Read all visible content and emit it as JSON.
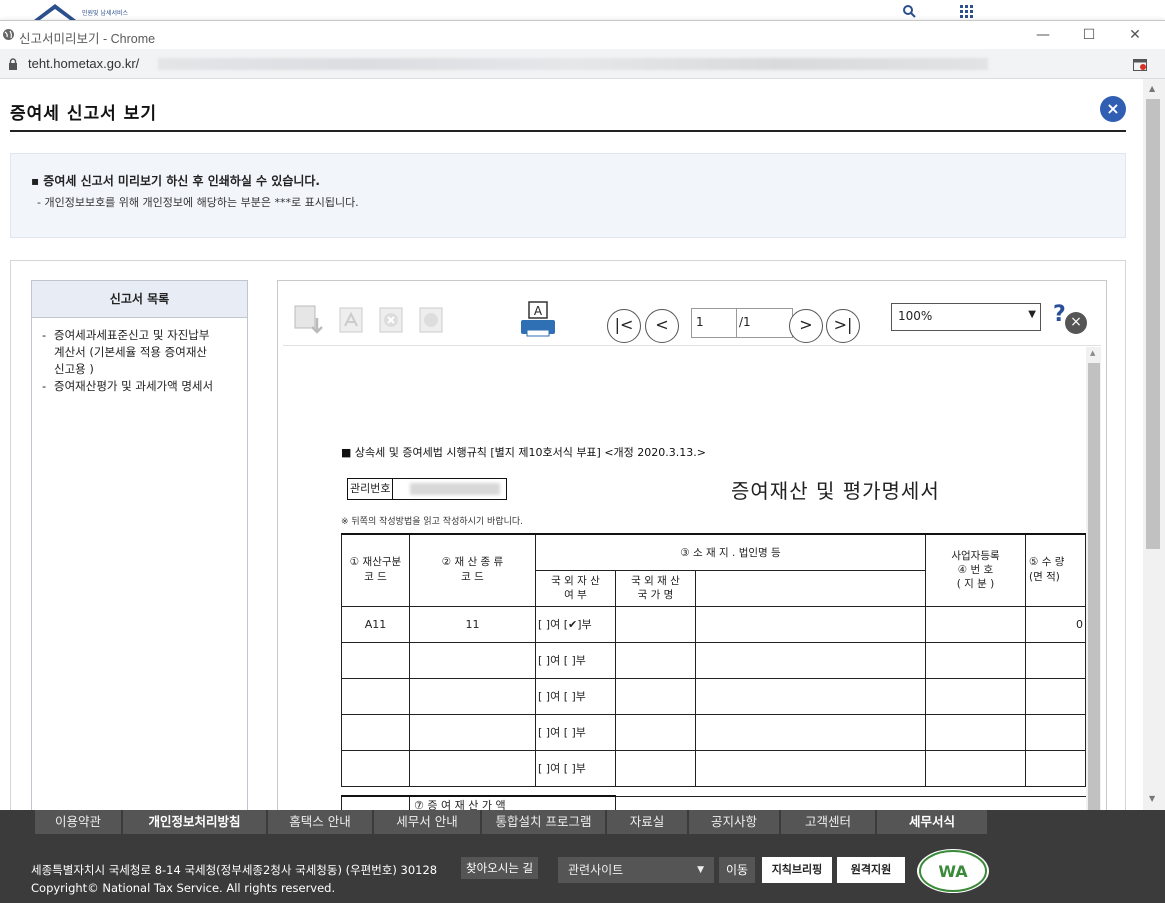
{
  "background_page": {
    "logo_text": "민원및 납세서비스"
  },
  "window": {
    "title": "신고서미리보기 - Chrome",
    "url": "teht.hometax.go.kr/",
    "controls": {
      "minimize": "—",
      "maximize": "☐",
      "close": "✕"
    }
  },
  "page": {
    "title": "증여세 신고서 보기",
    "close_symbol": "×"
  },
  "notice": {
    "line1": "▪ 증여세 신고서 미리보기 하신 후 인쇄하실 수 있습니다.",
    "line2": "- 개인정보보호를 위해 개인정보에 해당하는 부분은   ***로 표시됩니다."
  },
  "toc": {
    "heading": "신고서 목록",
    "items": [
      {
        "lines": [
          "증여세과세표준신고 및 자진납부",
          "계산서 (기본세율 적용 증여재산",
          "신고용 )"
        ]
      },
      {
        "lines": [
          "증여재산평가 및 과세가액 명세서"
        ]
      }
    ],
    "bullet": "-"
  },
  "viewer": {
    "print_label": "A",
    "page_current": "1",
    "page_total": "/1",
    "zoom": "100%",
    "help": "?",
    "nav": {
      "first": "|<",
      "prev": "<",
      "next": ">",
      "last": ">|"
    }
  },
  "document": {
    "form_ref": "■ 상속세 및 증여세법 시행규칙 [별지 제10호서식 부표] <개정 2020.3.13.>",
    "mgmt_label": "관리번호",
    "heading": "증여재산 및 평가명세서",
    "note": "※ 뒤쪽의 작성방법을 읽고 작성하시기 바랍니다.",
    "headers": {
      "col1": [
        "① 재산구분",
        "코   드"
      ],
      "col2": [
        "② 재  산  종  류",
        "코               드"
      ],
      "col3": "③ 소 재 지 . 법인명 등",
      "col3a": [
        "국 외 자 산",
        "여         부"
      ],
      "col3b": [
        "국 외 재 산",
        "국   가   명"
      ],
      "col4": [
        "사업자등록",
        "④ 번         호",
        "(  지  분  )"
      ],
      "col5": [
        "⑤ 수    량",
        "(면  적)"
      ]
    },
    "rows": [
      {
        "code": "A11",
        "kind": "11",
        "foreign": "[ ]여 [✔]부",
        "qty": "0"
      },
      {
        "code": "",
        "kind": "",
        "foreign": "[ ]여 [ ]부",
        "qty": ""
      },
      {
        "code": "",
        "kind": "",
        "foreign": "[ ]여 [ ]부",
        "qty": ""
      },
      {
        "code": "",
        "kind": "",
        "foreign": "[ ]여 [ ]부",
        "qty": ""
      },
      {
        "code": "",
        "kind": "",
        "foreign": "[ ]여 [ ]부",
        "qty": ""
      }
    ],
    "total_label": "⑦ 증   여   재   산   가   액"
  },
  "footer": {
    "nav": [
      "이용약관",
      "개인정보처리방침",
      "홈택스 안내",
      "세무서 안내",
      "통합설치 프로그램",
      "자료실",
      "공지사항",
      "고객센터",
      "세무서식"
    ],
    "address": "세종특별자치시 국세청로 8-14 국세청(정부세종2청사 국세청동) (우편번호) 30128",
    "directions": "찾아오시는 길",
    "copyright": "Copyright© National Tax Service. All rights reserved.",
    "related_sites": "관련사이트",
    "go": "이동",
    "badge1": "지칙브리핑",
    "badge2": "원격지원",
    "wa_text": "WA"
  },
  "colors": {
    "accent_blue": "#2f5eb3",
    "footer_bg": "#3b3b3b",
    "notice_bg": "#f2f6fb"
  }
}
